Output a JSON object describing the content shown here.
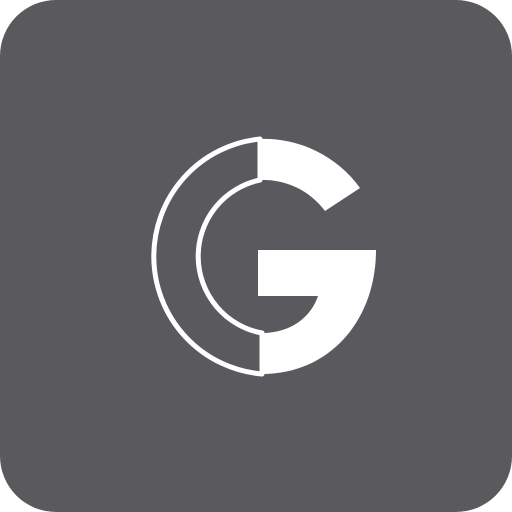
{
  "icon": {
    "name": "google-g-icon",
    "background_color": "#5a595e",
    "glyph_color": "#ffffff"
  }
}
